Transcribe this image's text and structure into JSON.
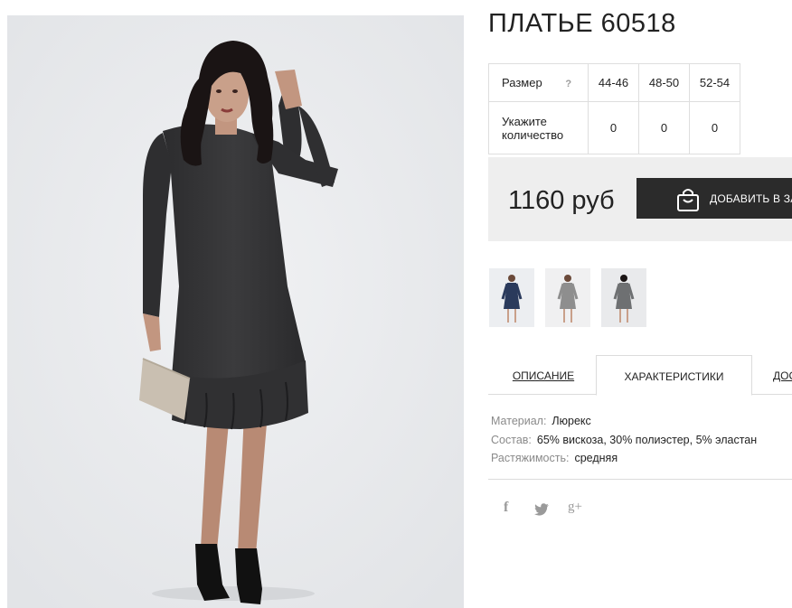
{
  "product": {
    "title": "ПЛАТЬЕ 60518",
    "photo_alt": "dress-photo"
  },
  "size_table": {
    "size_label": "Размер",
    "help_mark": "?",
    "quantity_label_line1": "Укажите",
    "quantity_label_line2": "количество",
    "sizes": [
      "44-46",
      "48-50",
      "52-54"
    ],
    "quantities": [
      "0",
      "0",
      "0"
    ]
  },
  "purchase": {
    "price": "1160 руб",
    "add_to_cart_label": "ДОБАВИТЬ В ЗАКАЗ"
  },
  "thumbnails": [
    {
      "name": "thumb-navy",
      "dress_color": "#2a3a5c"
    },
    {
      "name": "thumb-grey",
      "dress_color": "#8e8e8e"
    },
    {
      "name": "thumb-melange",
      "dress_color": "#6e7072"
    }
  ],
  "tabs": [
    {
      "label": "ОПИСАНИЕ",
      "active": false
    },
    {
      "label": "ХАРАКТЕРИСТИКИ",
      "active": true
    },
    {
      "label": "ДОСТАВКА",
      "active": false
    }
  ],
  "specs": [
    {
      "key": "Материал:",
      "value": "Люрекс"
    },
    {
      "key": "Состав:",
      "value": "65% вискоза, 30% полиэстер, 5% эластан"
    },
    {
      "key": "Растяжимость:",
      "value": "средняя"
    }
  ],
  "social": {
    "facebook": "f",
    "google_plus": "g+"
  },
  "colors": {
    "button_bg": "#2b2b2b",
    "price_panel_bg": "#eeeeee",
    "border": "#dedede",
    "muted_text": "#8a8a8a"
  }
}
